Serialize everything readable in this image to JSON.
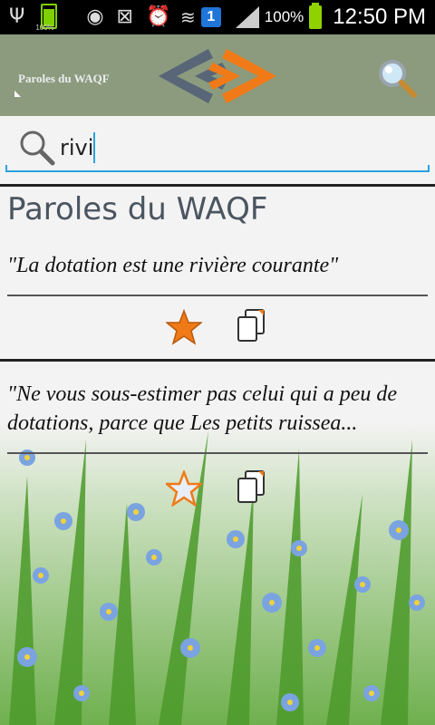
{
  "status_bar": {
    "battery_small_label": "100%",
    "notification_count": "1",
    "battery_percent": "100%",
    "time": "12:50 PM"
  },
  "app_bar": {
    "title": "Paroles du WAQF",
    "logo_colors": {
      "blue": "#4f5d77",
      "orange": "#f07a17"
    },
    "search_icon": "search-icon"
  },
  "search": {
    "value": "rivi",
    "icon": "search-icon"
  },
  "list": {
    "header": "Paroles du WAQF",
    "items": [
      {
        "quote": "\"La dotation est une rivière courante\"",
        "favorite": true
      },
      {
        "quote": "\"Ne vous sous-estimer pas celui qui a peu de dotations, parce que Les petits ruissea...",
        "favorite": false
      }
    ]
  },
  "colors": {
    "accent": "#2aa2dd",
    "star_active": "#f07a17",
    "actionbar": "#8c9b7d"
  }
}
